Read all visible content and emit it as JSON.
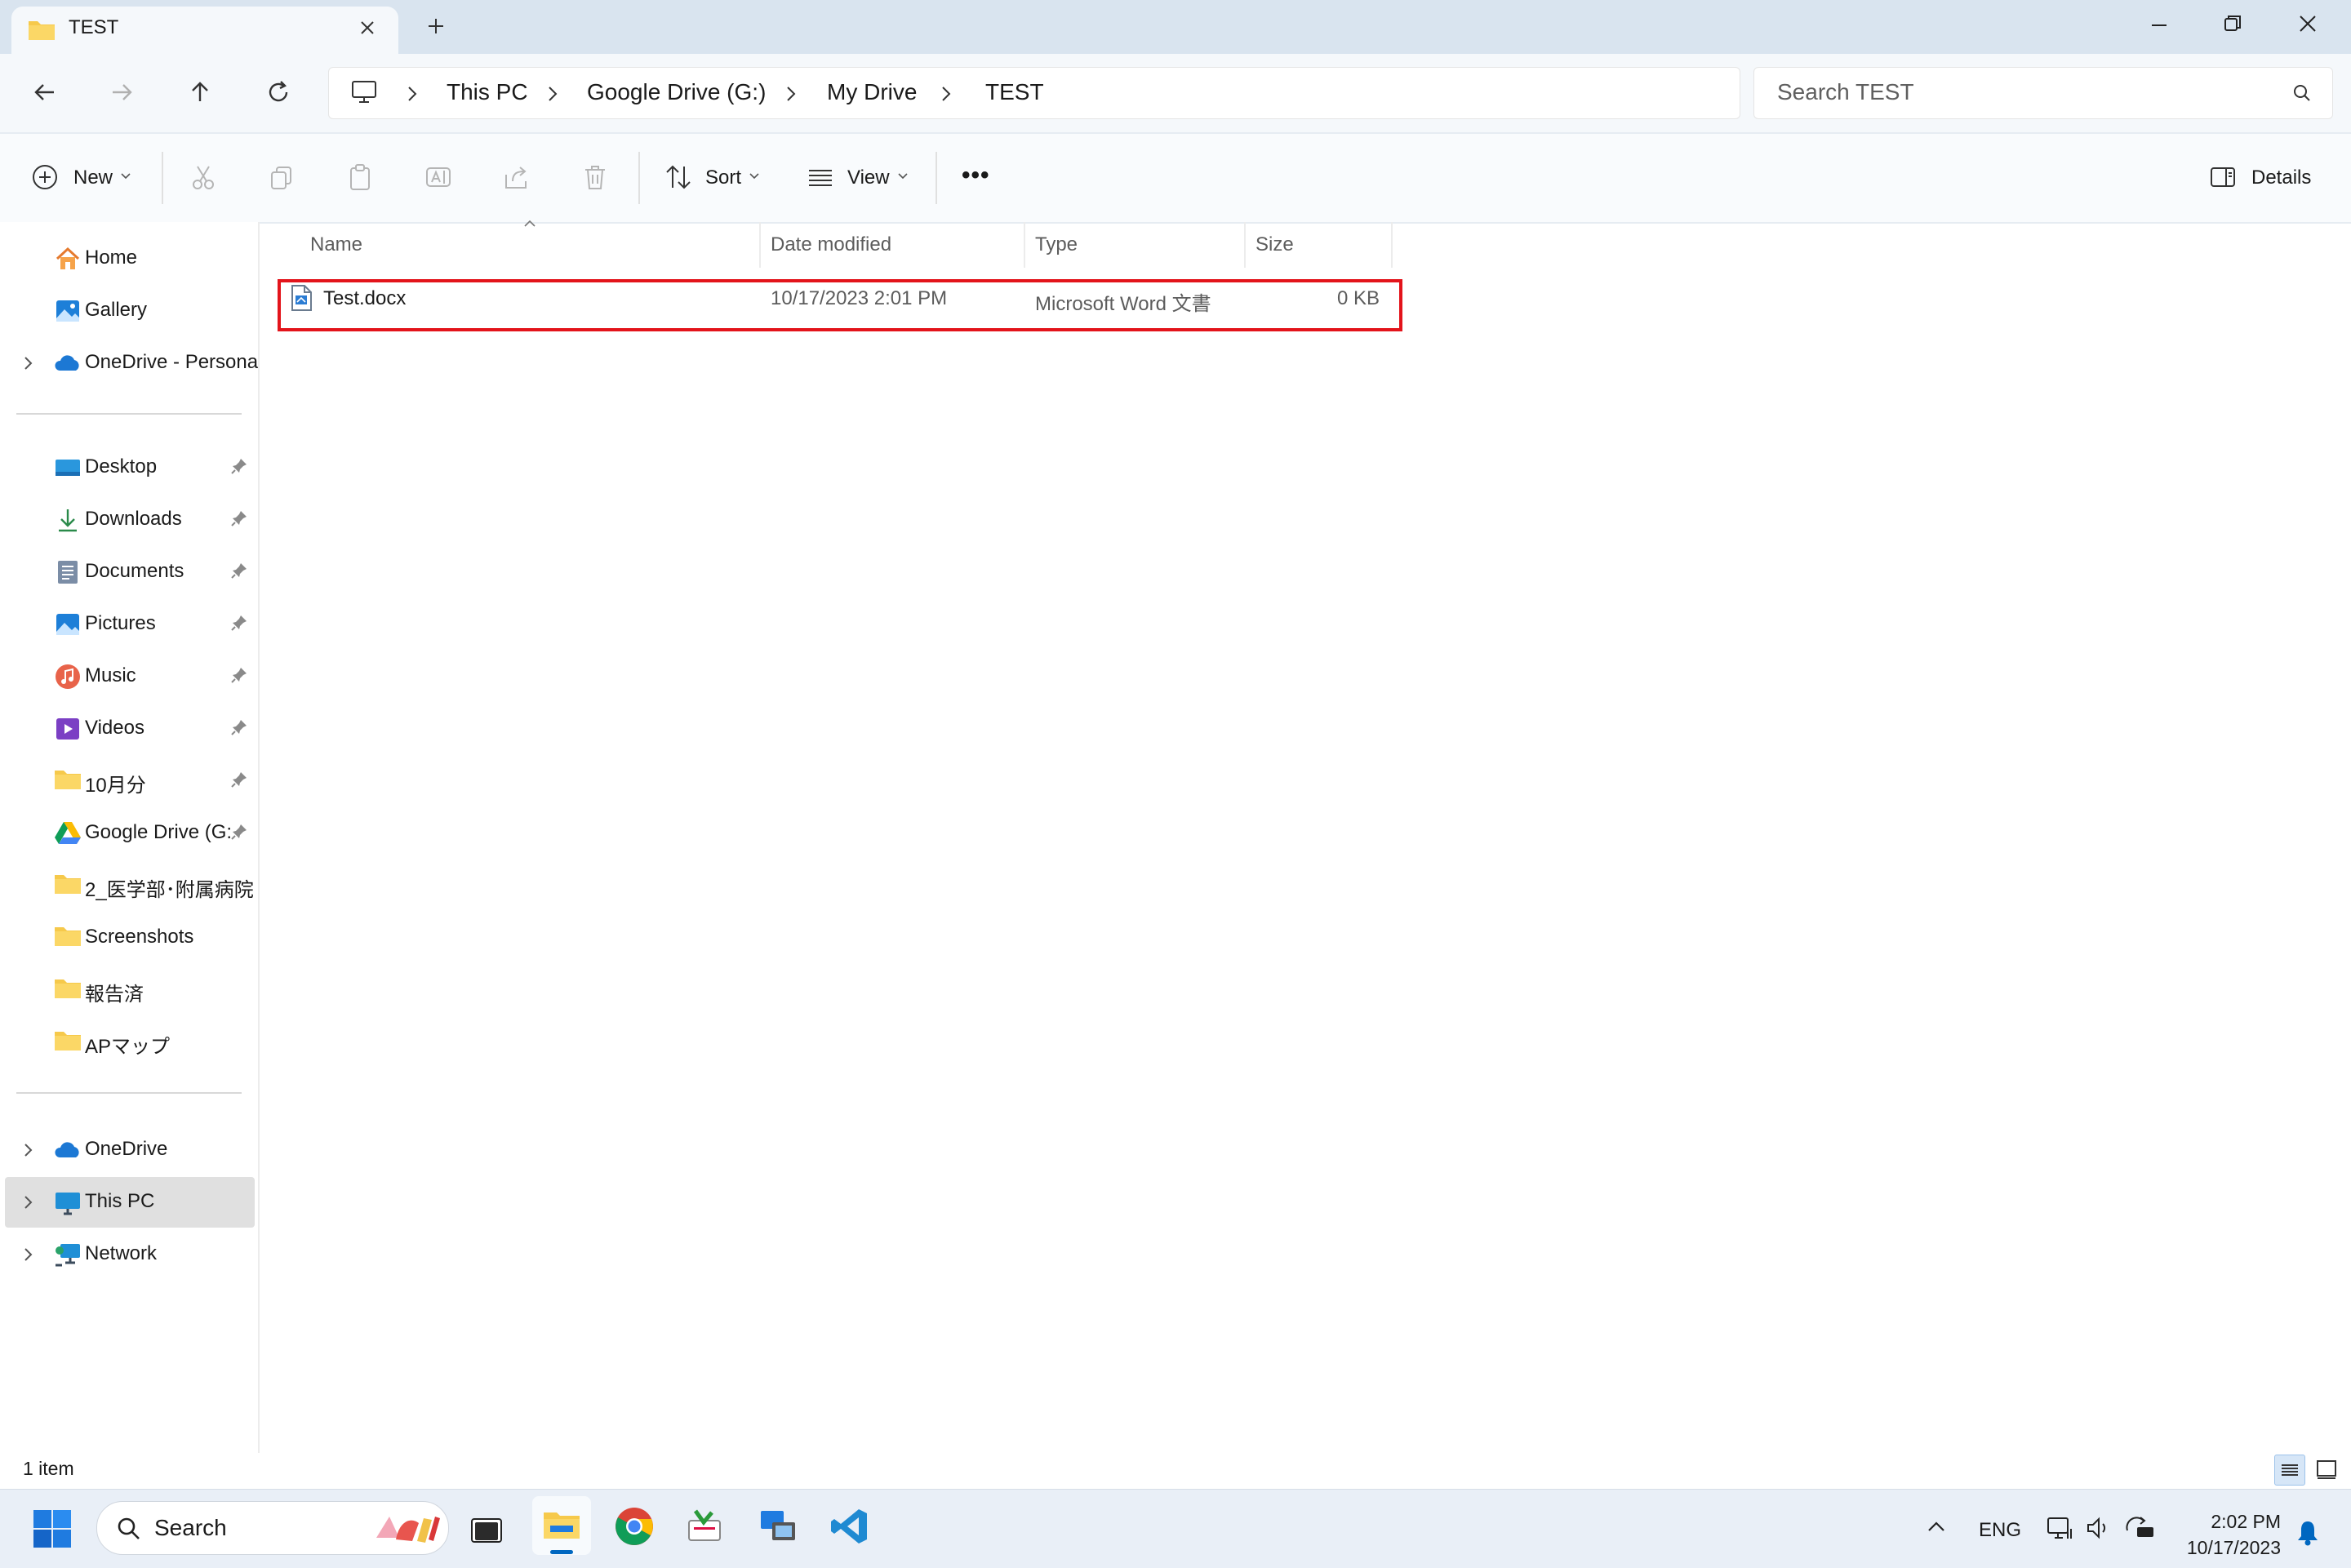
{
  "tab": {
    "title": "TEST",
    "close": "✕",
    "new": "+"
  },
  "window": {
    "minimize": "—",
    "maximize": "❐",
    "close": "✕"
  },
  "nav": {
    "back": "←",
    "forward": "→",
    "up": "↑",
    "refresh": "⟳"
  },
  "breadcrumb": [
    "This PC",
    "Google Drive (G:)",
    "My Drive",
    "TEST"
  ],
  "search": {
    "placeholder": "Search TEST"
  },
  "toolbar": {
    "new_label": "New",
    "sort_label": "Sort",
    "view_label": "View",
    "more_label": "•••",
    "details_label": "Details"
  },
  "sidebar": {
    "top": [
      {
        "label": "Home",
        "icon": "home-icon"
      },
      {
        "label": "Gallery",
        "icon": "gallery-icon"
      },
      {
        "label": "OneDrive - Persona",
        "icon": "cloud-icon"
      }
    ],
    "quick": [
      {
        "label": "Desktop",
        "icon": "desktop-icon"
      },
      {
        "label": "Downloads",
        "icon": "download-icon"
      },
      {
        "label": "Documents",
        "icon": "documents-icon"
      },
      {
        "label": "Pictures",
        "icon": "pictures-icon"
      },
      {
        "label": "Music",
        "icon": "music-icon"
      },
      {
        "label": "Videos",
        "icon": "videos-icon"
      },
      {
        "label": "10月分",
        "icon": "folder-icon"
      },
      {
        "label": "Google Drive (G:",
        "icon": "google-drive-icon"
      },
      {
        "label": "2_医学部･附属病院",
        "icon": "folder-icon"
      },
      {
        "label": "Screenshots",
        "icon": "folder-icon"
      },
      {
        "label": "報告済",
        "icon": "folder-icon"
      },
      {
        "label": "APマップ",
        "icon": "folder-icon"
      }
    ],
    "bottom": [
      {
        "label": "OneDrive",
        "icon": "cloud-icon"
      },
      {
        "label": "This PC",
        "icon": "computer-icon"
      },
      {
        "label": "Network",
        "icon": "network-icon"
      }
    ]
  },
  "columns": {
    "name": "Name",
    "date": "Date modified",
    "type": "Type",
    "size": "Size"
  },
  "files": [
    {
      "name": "Test.docx",
      "date": "10/17/2023 2:01 PM",
      "type": "Microsoft Word 文書",
      "size": "0 KB"
    }
  ],
  "status": {
    "count": "1 item"
  },
  "taskbar": {
    "search_label": "Search",
    "lang": "ENG",
    "time": "2:02 PM",
    "date": "10/17/2023"
  },
  "colors": {
    "accent": "#0067c0",
    "highlight": "#e3141b",
    "folder": "#f6c94b"
  }
}
